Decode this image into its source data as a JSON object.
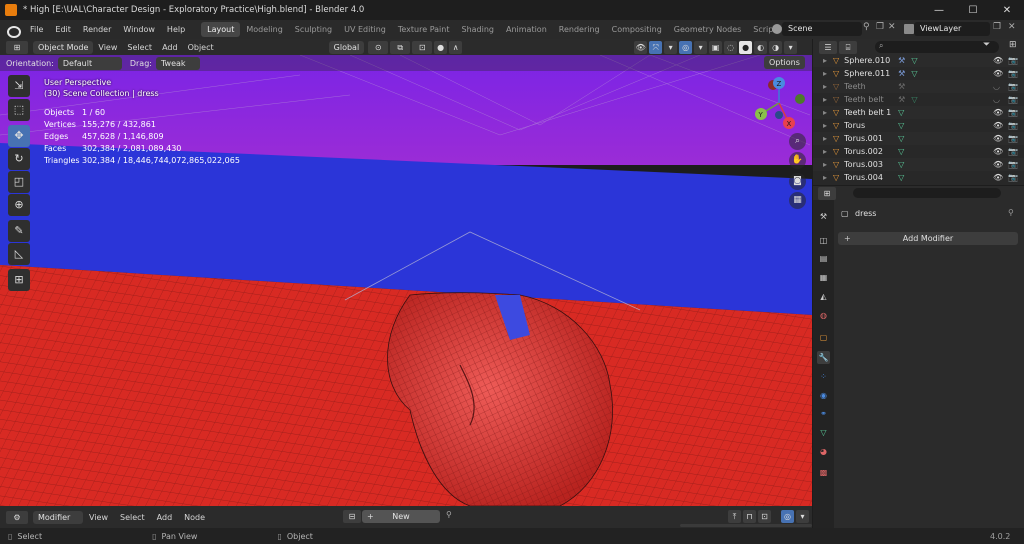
{
  "titlebar": {
    "title": "* High [E:\\UAL\\Character Design - Exploratory Practice\\High.blend] - Blender 4.0",
    "minimize": "—",
    "maximize": "☐",
    "close": "✕"
  },
  "menus": [
    "File",
    "Edit",
    "Render",
    "Window",
    "Help"
  ],
  "workspaces": [
    "Layout",
    "Modeling",
    "Sculpting",
    "UV Editing",
    "Texture Paint",
    "Shading",
    "Animation",
    "Rendering",
    "Compositing",
    "Geometry Nodes",
    "Scripting"
  ],
  "scene": {
    "name": "Scene",
    "viewlayer": "ViewLayer"
  },
  "viewport_header": {
    "mode": "Object Mode",
    "view": "View",
    "select": "Select",
    "add": "Add",
    "object": "Object",
    "transform": "Global"
  },
  "viewport_subheader": {
    "orientation_label": "Orientation:",
    "orientation": "Default",
    "drag_label": "Drag:",
    "drag": "Tweak",
    "options": "Options"
  },
  "viewport_info": {
    "perspective": "User Perspective",
    "collection": "(30) Scene Collection | dress",
    "stats": [
      {
        "label": "Objects",
        "value": "1 / 60"
      },
      {
        "label": "Vertices",
        "value": "155,276 / 432,861"
      },
      {
        "label": "Edges",
        "value": "457,628 / 1,146,809"
      },
      {
        "label": "Faces",
        "value": "302,384 / 2,081,089,430"
      },
      {
        "label": "Triangles",
        "value": "302,384 / 18,446,744,072,865,022,065"
      }
    ]
  },
  "gizmo": {
    "x": "X",
    "y": "Y",
    "z": "Z"
  },
  "outliner": {
    "items": [
      {
        "name": "Sphere.010",
        "dim": false
      },
      {
        "name": "Sphere.011",
        "dim": false
      },
      {
        "name": "Teeth",
        "dim": true
      },
      {
        "name": "Teeth belt",
        "dim": true
      },
      {
        "name": "Teeth belt 1",
        "dim": false
      },
      {
        "name": "Torus",
        "dim": false
      },
      {
        "name": "Torus.001",
        "dim": false
      },
      {
        "name": "Torus.002",
        "dim": false
      },
      {
        "name": "Torus.003",
        "dim": false
      },
      {
        "name": "Torus.004",
        "dim": false
      }
    ]
  },
  "properties": {
    "object_name": "dress",
    "add_modifier": "Add Modifier"
  },
  "node_header": {
    "editor": "Modifier",
    "view": "View",
    "select": "Select",
    "add": "Add",
    "node": "Node",
    "new": "New"
  },
  "statusbar": {
    "select": "Select",
    "pan": "Pan View",
    "object": "Object",
    "version": "4.0.2"
  },
  "colors": {
    "accent": "#4772b3",
    "brand": "#e87d0d",
    "mesh_red": "#d82a23",
    "plane_blue": "#2b35d8",
    "bg_purple": "#8a2be0"
  }
}
